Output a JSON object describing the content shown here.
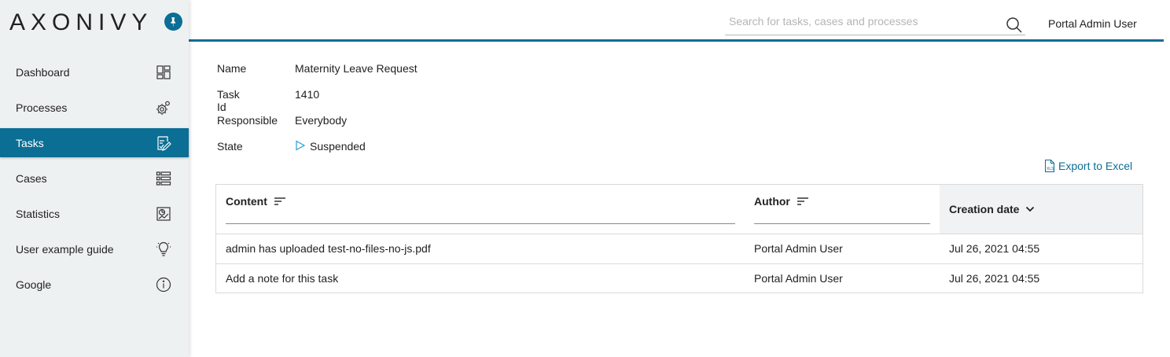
{
  "brand": {
    "logo": "AXONIVY"
  },
  "sidebar": {
    "items": [
      {
        "label": "Dashboard",
        "icon": "dashboard-icon"
      },
      {
        "label": "Processes",
        "icon": "processes-gears-icon"
      },
      {
        "label": "Tasks",
        "icon": "tasks-icon",
        "active": true
      },
      {
        "label": "Cases",
        "icon": "cases-list-icon"
      },
      {
        "label": "Statistics",
        "icon": "statistics-icon"
      },
      {
        "label": "User example guide",
        "icon": "lightbulb-icon"
      },
      {
        "label": "Google",
        "icon": "info-icon"
      }
    ]
  },
  "header": {
    "search_placeholder": "Search for tasks, cases and processes",
    "user": "Portal Admin User"
  },
  "task": {
    "name_label": "Name",
    "name": "Maternity Leave Request",
    "id_label": "Task Id",
    "id": "1410",
    "responsible_label": "Responsible",
    "responsible": "Everybody",
    "state_label": "State",
    "state": "Suspended"
  },
  "export": {
    "label": "Export to Excel"
  },
  "notes_table": {
    "columns": {
      "content": "Content",
      "author": "Author",
      "created": "Creation date"
    },
    "rows": [
      {
        "content": "admin has uploaded test-no-files-no-js.pdf",
        "author": "Portal Admin User",
        "created": "Jul 26, 2021 04:55"
      },
      {
        "content": "Add a note for this task",
        "author": "Portal Admin User",
        "created": "Jul 26, 2021 04:55"
      }
    ]
  },
  "colors": {
    "accent": "#0b6e94",
    "sidebar_bg": "#eef1f2",
    "state_icon": "#2a9bd6"
  }
}
